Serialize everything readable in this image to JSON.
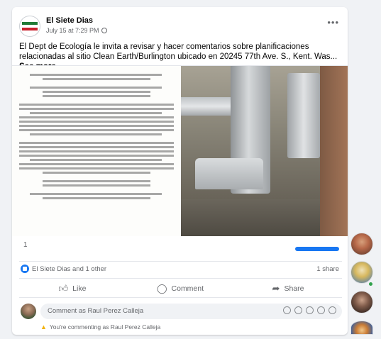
{
  "post": {
    "page_name": "El Siete Dias",
    "timestamp": "July 15 at 7:29 PM",
    "text": "El Dept de Ecología le invita a revisar y hacer comentarios sobre planificaciones relacionadas al sitio Clean Earth/Burlington ubicado en 20245 77th Ave. S., Kent. Was...",
    "see_more": "See more",
    "reaction_count": "1",
    "likes_text": "El Siete Dias and 1 other",
    "shares_text": "1 share"
  },
  "actions": {
    "like": "Like",
    "comment": "Comment",
    "share": "Share"
  },
  "comment": {
    "placeholder": "Comment as Raul Perez Calleja",
    "identity_notice": "You're commenting as Raul Perez Calleja"
  },
  "icons": {
    "more": "more-options-icon",
    "globe": "globe-icon",
    "like": "thumbs-up-icon",
    "comment": "speech-bubble-icon",
    "share": "share-arrow-icon",
    "warning": "warning-icon"
  },
  "colors": {
    "accent": "#1877f2",
    "online": "#31a24c",
    "warning": "#f2b20c"
  }
}
